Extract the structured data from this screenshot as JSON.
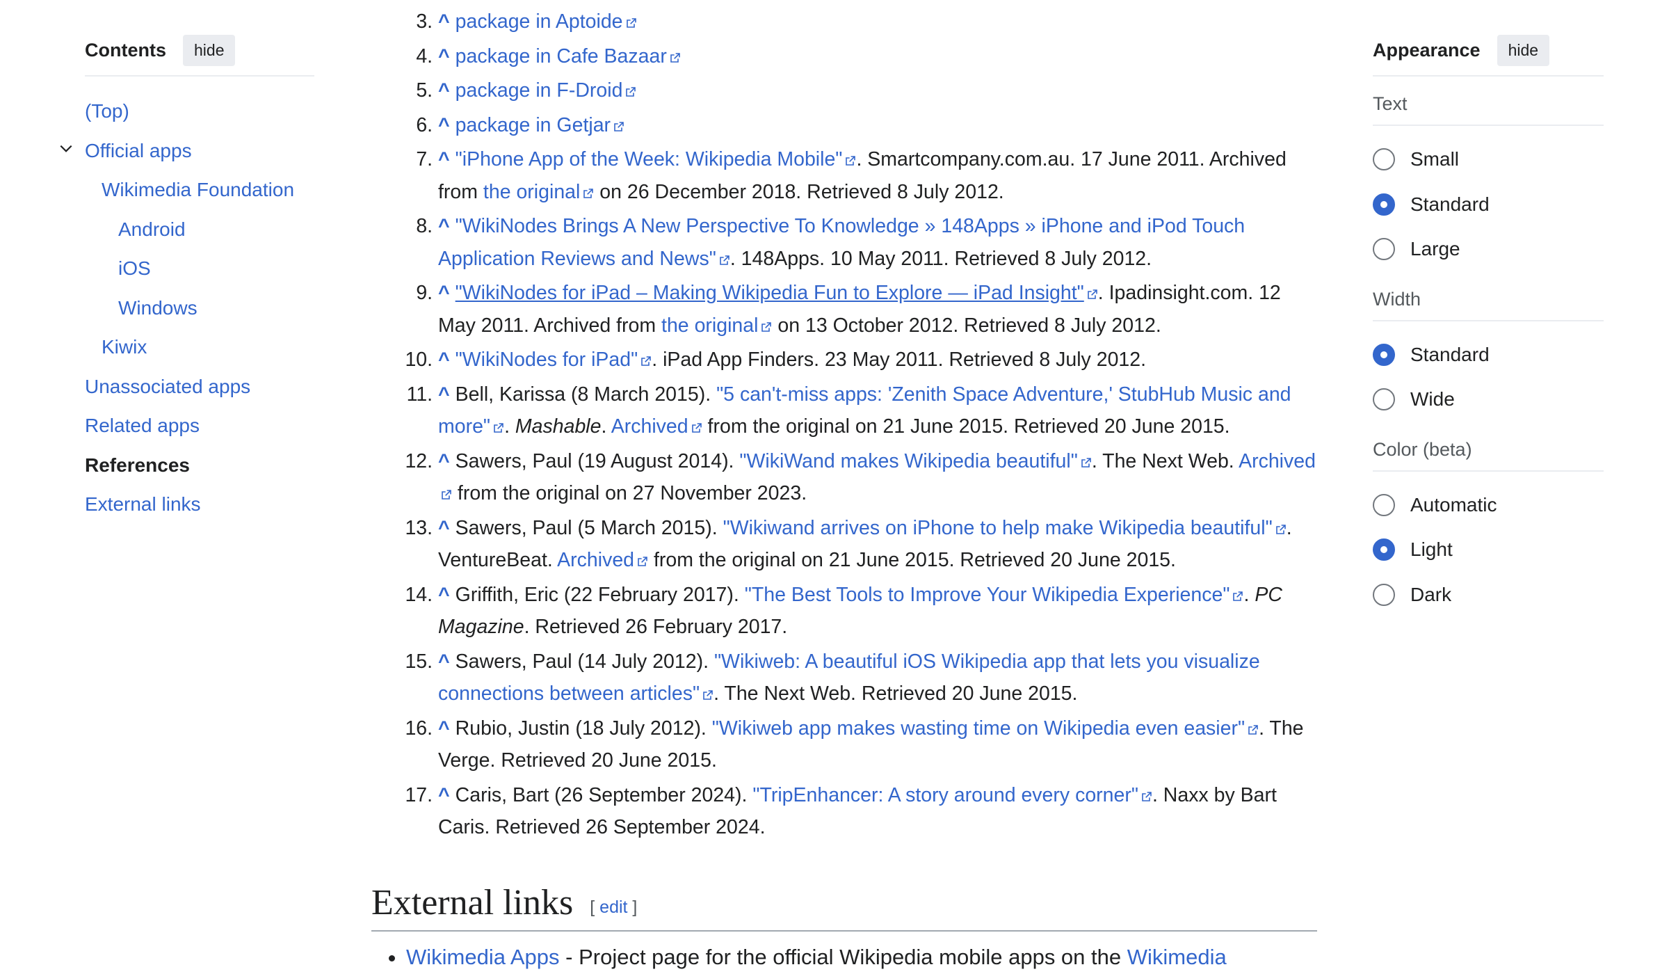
{
  "toc": {
    "title": "Contents",
    "hide_label": "hide",
    "items": [
      {
        "label": "(Top)"
      },
      {
        "label": "Official apps"
      },
      {
        "label": "Wikimedia Foundation"
      },
      {
        "label": "Android"
      },
      {
        "label": "iOS"
      },
      {
        "label": "Windows"
      },
      {
        "label": "Kiwix"
      },
      {
        "label": "Unassociated apps"
      },
      {
        "label": "Related apps"
      },
      {
        "label": "References"
      },
      {
        "label": "External links"
      }
    ]
  },
  "references": {
    "caret": "^",
    "r3": {
      "link": "package in Aptoide"
    },
    "r4": {
      "link": "package in Cafe Bazaar"
    },
    "r5": {
      "link": "package in F-Droid"
    },
    "r6": {
      "link": "package in Getjar"
    },
    "r7": {
      "title": "\"iPhone App of the Week: Wikipedia Mobile\"",
      "mid": ". Smartcompany.com.au. 17 June 2011. Archived from ",
      "archive": "the original",
      "end": " on 26 December 2018. Retrieved 8 July 2012."
    },
    "r8": {
      "title": "\"WikiNodes Brings A New Perspective To Knowledge » 148Apps » iPhone and iPod Touch Application Reviews and News\"",
      "end": ". 148Apps. 10 May 2011. Retrieved 8 July 2012."
    },
    "r9": {
      "title": "\"WikiNodes for iPad – Making Wikipedia Fun to Explore — iPad Insight\"",
      "mid": ". Ipadinsight.com. 12 May 2011. Archived from ",
      "archive": "the original",
      "end": " on 13 October 2012. Retrieved 8 July 2012."
    },
    "r10": {
      "title": "\"WikiNodes for iPad\"",
      "end": ". iPad App Finders. 23 May 2011. Retrieved 8 July 2012."
    },
    "r11": {
      "pre": "Bell, Karissa (8 March 2015). ",
      "title": "\"5 can't-miss apps: 'Zenith Space Adventure,' StubHub Music and more\"",
      "dot": ". ",
      "work": "Mashable",
      "dot2": ". ",
      "archive": "Archived",
      "end": " from the original on 21 June 2015. Retrieved 20 June 2015."
    },
    "r12": {
      "pre": "Sawers, Paul (19 August 2014). ",
      "title": "\"WikiWand makes Wikipedia beautiful\"",
      "mid": ". The Next Web. ",
      "archive": "Archived",
      "end": " from the original on 27 November 2023."
    },
    "r13": {
      "pre": "Sawers, Paul (5 March 2015). ",
      "title": "\"Wikiwand arrives on iPhone to help make Wikipedia beautiful\"",
      "mid": ". VentureBeat. ",
      "archive": "Archived",
      "end": " from the original on 21 June 2015. Retrieved 20 June 2015."
    },
    "r14": {
      "pre": "Griffith, Eric (22 February 2017). ",
      "title": "\"The Best Tools to Improve Your Wikipedia Experience\"",
      "dot": ". ",
      "work": "PC Magazine",
      "end": ". Retrieved 26 February 2017."
    },
    "r15": {
      "pre": "Sawers, Paul (14 July 2012). ",
      "title": "\"Wikiweb: A beautiful iOS Wikipedia app that lets you visualize connections between articles\"",
      "end": ". The Next Web. Retrieved 20 June 2015."
    },
    "r16": {
      "pre": "Rubio, Justin (18 July 2012). ",
      "title": "\"Wikiweb app makes wasting time on Wikipedia even easier\"",
      "end": ". The Verge. Retrieved 20 June 2015."
    },
    "r17": {
      "pre": "Caris, Bart (26 September 2024). ",
      "title": "\"TripEnhancer: A story around every corner\"",
      "end": ". Naxx by Bart Caris. Retrieved 26 September 2024."
    }
  },
  "external_links": {
    "heading": "External links",
    "edit_open": "[ ",
    "edit_label": "edit",
    "edit_close": " ]",
    "item1": {
      "link": "Wikimedia Apps",
      "text": " - Project page for the official Wikipedia mobile apps on the ",
      "link2": "Wikimedia"
    }
  },
  "appearance": {
    "title": "Appearance",
    "hide_label": "hide",
    "text_group": {
      "label": "Text",
      "options": [
        "Small",
        "Standard",
        "Large"
      ],
      "selected": "Standard"
    },
    "width_group": {
      "label": "Width",
      "options": [
        "Standard",
        "Wide"
      ],
      "selected": "Standard"
    },
    "color_group": {
      "label": "Color (beta)",
      "options": [
        "Automatic",
        "Light",
        "Dark"
      ],
      "selected": "Light"
    }
  },
  "colors": {
    "link": "#3366cc",
    "text": "#202122",
    "muted": "#54595d",
    "divider": "#eaecf0"
  }
}
